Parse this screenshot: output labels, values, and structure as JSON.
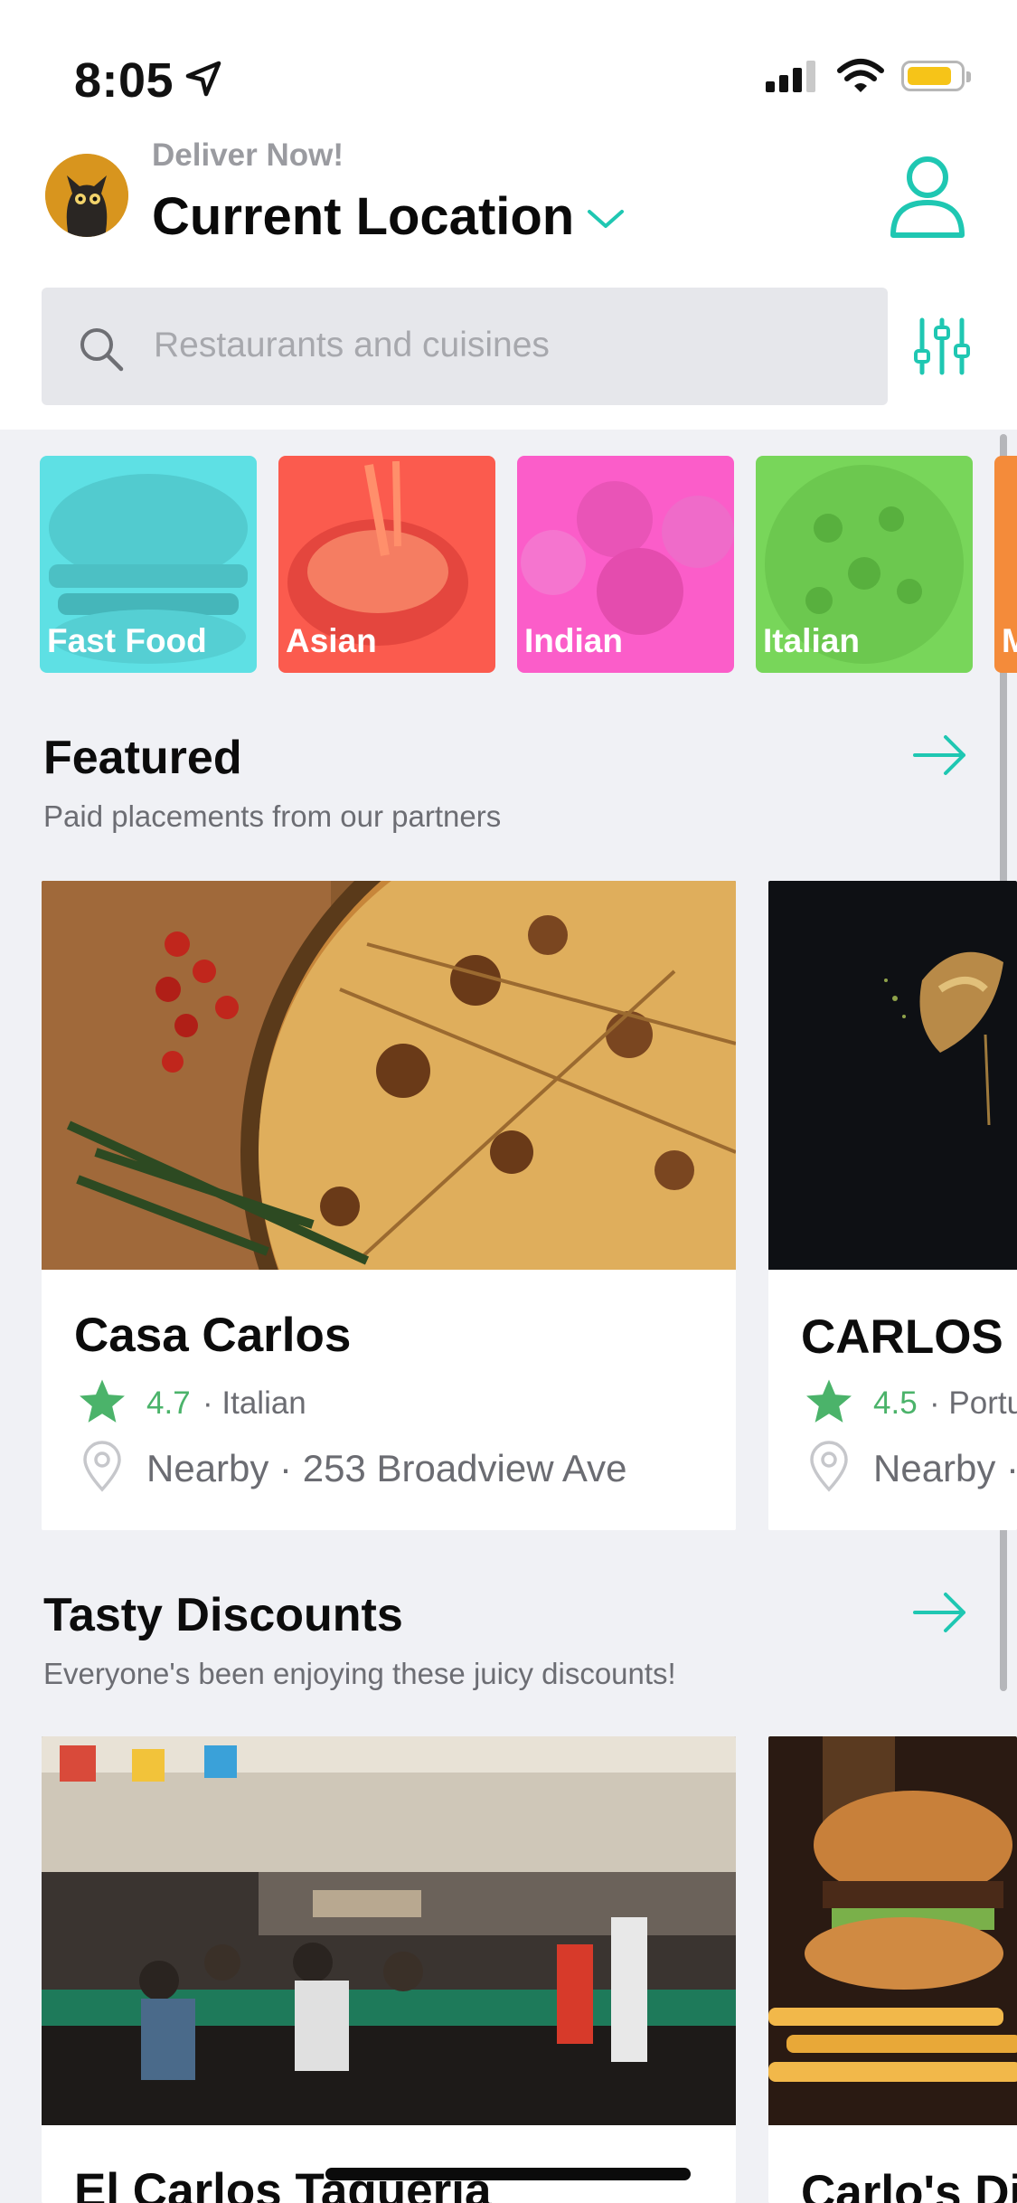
{
  "status_bar": {
    "time": "8:05"
  },
  "header": {
    "deliver_label": "Deliver Now!",
    "location": "Current Location"
  },
  "search": {
    "placeholder": "Restaurants and cuisines"
  },
  "categories": [
    {
      "label": "Fast Food",
      "color": "#5ee0e4"
    },
    {
      "label": "Asian",
      "color": "#fb5b4e"
    },
    {
      "label": "Indian",
      "color": "#fb5dc9"
    },
    {
      "label": "Italian",
      "color": "#78d65a"
    },
    {
      "label": "M",
      "color": "#f48b3a"
    }
  ],
  "featured": {
    "title": "Featured",
    "subtitle": "Paid placements from our partners",
    "cards": [
      {
        "name": "Casa Carlos",
        "rating": "4.7",
        "cuisine": " · Italian",
        "address": "Nearby · 253 Broadview Ave"
      },
      {
        "name": "CARLOS",
        "rating": "4.5",
        "cuisine": " · Portu",
        "address": "Nearby ·"
      }
    ]
  },
  "discounts": {
    "title": "Tasty Discounts",
    "subtitle": "Everyone's been enjoying these juicy discounts!",
    "cards": [
      {
        "name": "El Carlos Taqueria"
      },
      {
        "name": "Carlo's Di"
      }
    ]
  },
  "colors": {
    "accent": "#1fc7b2",
    "rating_green": "#4bb36a",
    "background": "#f0f1f5"
  }
}
